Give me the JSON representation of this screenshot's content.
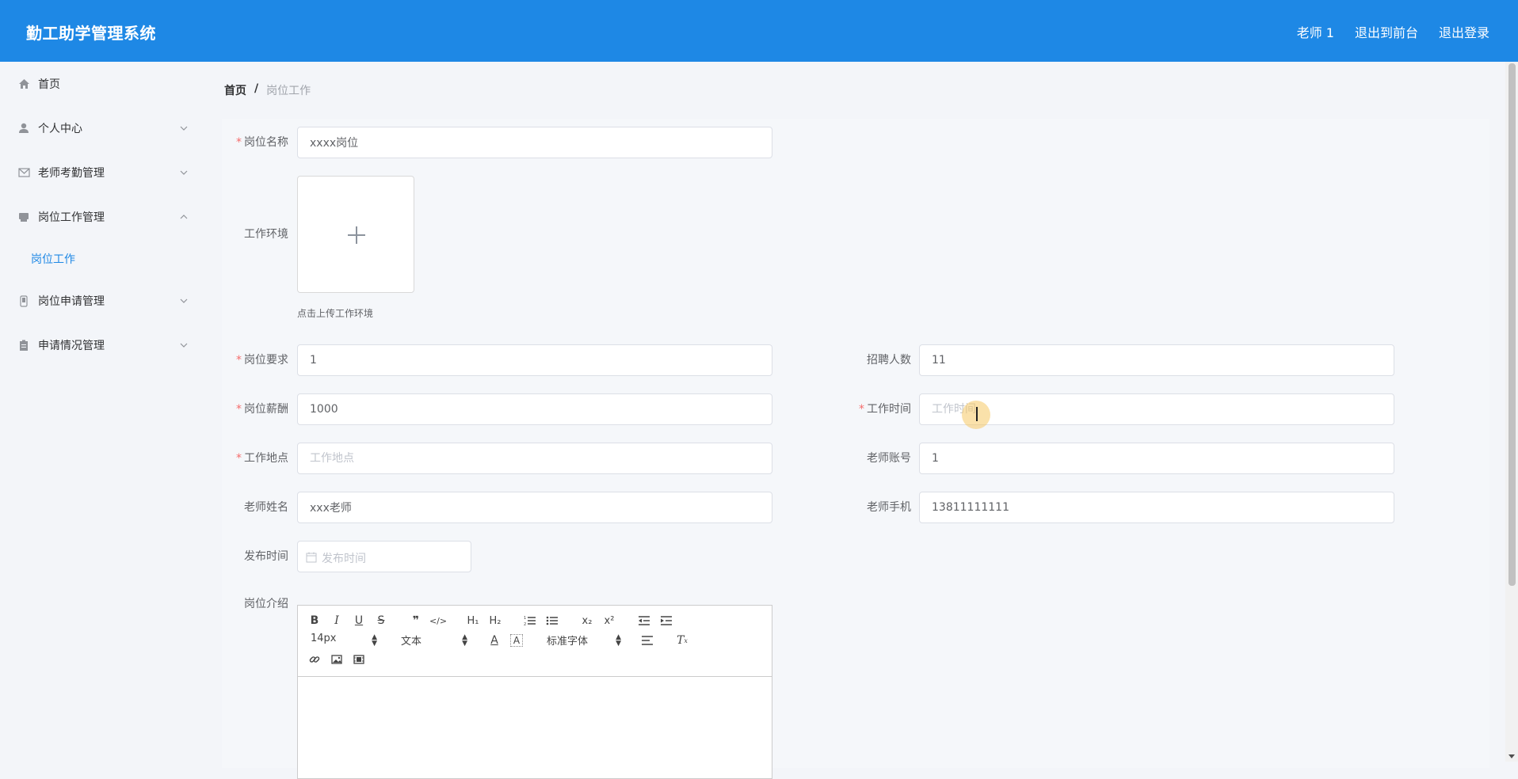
{
  "header": {
    "app_title": "勤工助学管理系统",
    "user": "老师 1",
    "back_to_front": "退出到前台",
    "logout": "退出登录"
  },
  "sidebar": {
    "items": [
      {
        "label": "首页",
        "icon": "home-icon"
      },
      {
        "label": "个人中心",
        "icon": "user-icon"
      },
      {
        "label": "老师考勤管理",
        "icon": "envelope-icon"
      },
      {
        "label": "岗位工作管理",
        "icon": "printer-icon"
      },
      {
        "label": "岗位工作",
        "icon": ""
      },
      {
        "label": "岗位申请管理",
        "icon": "phone-icon"
      },
      {
        "label": "申请情况管理",
        "icon": "clipboard-icon"
      }
    ]
  },
  "breadcrumb": {
    "home": "首页",
    "separator": "/",
    "current": "岗位工作"
  },
  "form": {
    "job_name": {
      "label": "岗位名称",
      "value": "xxxx岗位",
      "required": true
    },
    "environment": {
      "label": "工作环境",
      "tip": "点击上传工作环境"
    },
    "requirement": {
      "label": "岗位要求",
      "value": "1",
      "required": true
    },
    "headcount": {
      "label": "招聘人数",
      "value": "11"
    },
    "salary": {
      "label": "岗位薪酬",
      "value": "1000",
      "required": true
    },
    "work_time": {
      "label": "工作时间",
      "placeholder": "工作时间",
      "required": true
    },
    "location": {
      "label": "工作地点",
      "placeholder": "工作地点",
      "required": true
    },
    "teacher_account": {
      "label": "老师账号",
      "value": "1"
    },
    "teacher_name": {
      "label": "老师姓名",
      "value": "xxx老师"
    },
    "teacher_phone": {
      "label": "老师手机",
      "value": "13811111111"
    },
    "publish_time": {
      "label": "发布时间",
      "placeholder": "发布时间"
    },
    "intro": {
      "label": "岗位介绍"
    }
  },
  "editor": {
    "font_size": "14px",
    "header_select": "文本",
    "font_family": "标准字体",
    "h1": "H₁",
    "h2": "H₂",
    "sub": "x₂",
    "sup": "x²"
  },
  "colors": {
    "primary": "#1e88e5",
    "required": "#f56c6c"
  }
}
